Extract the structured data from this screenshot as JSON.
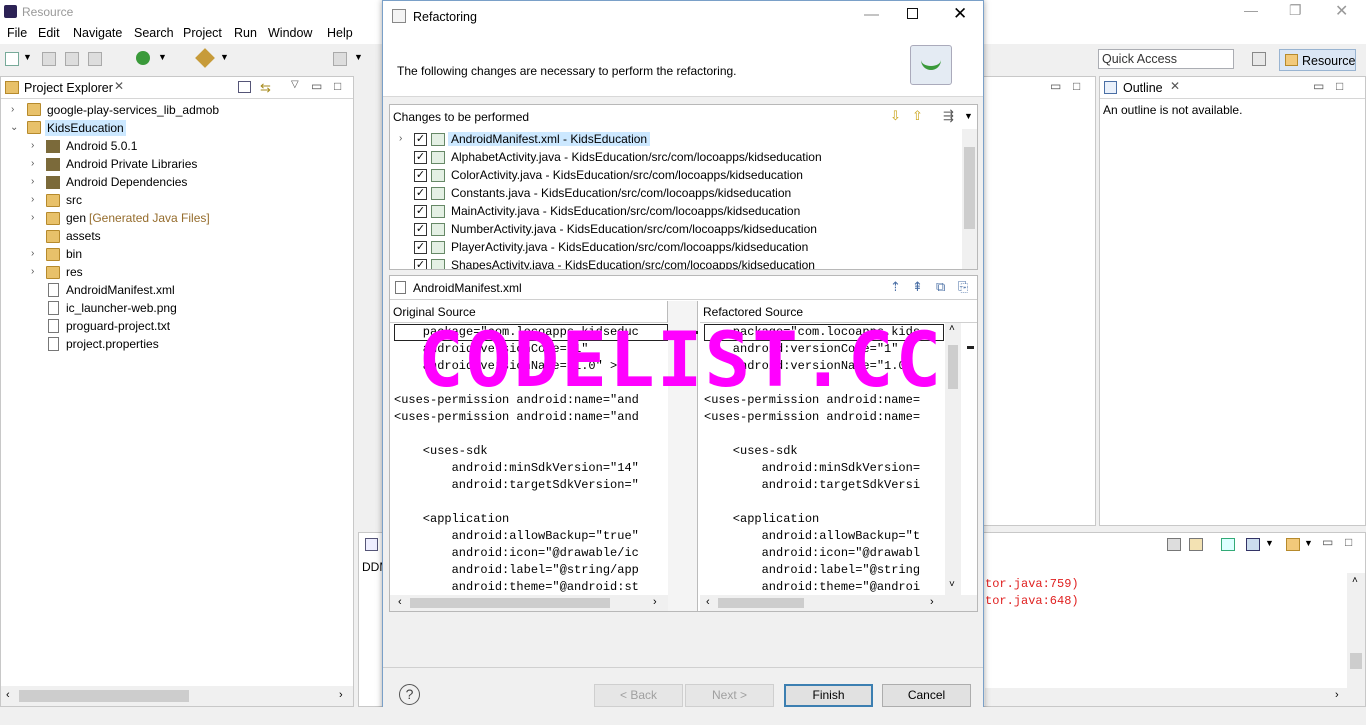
{
  "window": {
    "title": "Resource"
  },
  "menu": [
    "File",
    "Edit",
    "Navigate",
    "Search",
    "Project",
    "Run",
    "Window",
    "Help"
  ],
  "quick_access": {
    "placeholder": "Quick Access"
  },
  "perspective": {
    "label": "Resource"
  },
  "project_explorer": {
    "tab_label": "Project Explorer",
    "items": [
      {
        "label": "google-play-services_lib_admob"
      },
      {
        "label": "KidsEducation"
      },
      {
        "label": "Android 5.0.1"
      },
      {
        "label": "Android Private Libraries"
      },
      {
        "label": "Android Dependencies"
      },
      {
        "label": "src"
      },
      {
        "label": "gen",
        "suffix": "[Generated Java Files]"
      },
      {
        "label": "assets"
      },
      {
        "label": "bin"
      },
      {
        "label": "res"
      },
      {
        "label": "AndroidManifest.xml"
      },
      {
        "label": "ic_launcher-web.png"
      },
      {
        "label": "proguard-project.txt"
      },
      {
        "label": "project.properties"
      }
    ]
  },
  "outline": {
    "tab_label": "Outline",
    "message": "An outline is not available."
  },
  "console": {
    "tab_label": "DDM",
    "lines": [
      "tor.java:759)",
      "tor.java:648)"
    ]
  },
  "dialog": {
    "title": "Refactoring",
    "message": "The following changes are necessary to perform the refactoring.",
    "changes_label": "Changes to be performed",
    "changes": [
      "AndroidManifest.xml - KidsEducation",
      "AlphabetActivity.java - KidsEducation/src/com/locoapps/kidseducation",
      "ColorActivity.java - KidsEducation/src/com/locoapps/kidseducation",
      "Constants.java - KidsEducation/src/com/locoapps/kidseducation",
      "MainActivity.java - KidsEducation/src/com/locoapps/kidseducation",
      "NumberActivity.java - KidsEducation/src/com/locoapps/kidseducation",
      "PlayerActivity.java - KidsEducation/src/com/locoapps/kidseducation",
      "ShapesActivity.java - KidsEducation/src/com/locoapps/kidseducation"
    ],
    "compare_file": "AndroidManifest.xml",
    "original_label": "Original Source",
    "refactored_label": "Refactored Source",
    "original_code": "    package=\"com.locoapps.kidseduc\n    android:versionCode=\"1\"\n    android:versionName=\"1.0\" >\n\n<uses-permission android:name=\"and\n<uses-permission android:name=\"and\n\n    <uses-sdk\n        android:minSdkVersion=\"14\"\n        android:targetSdkVersion=\"\n\n    <application\n        android:allowBackup=\"true\"\n        android:icon=\"@drawable/ic\n        android:label=\"@string/app\n        android:theme=\"@android:st",
    "refactored_code": "    package=\"com.locoapps.kids\n    android:versionCode=\"1\"\n    android:versionName=\"1.0\"\n\n<uses-permission android:name=\n<uses-permission android:name=\n\n    <uses-sdk\n        android:minSdkVersion=\n        android:targetSdkVersi\n\n    <application\n        android:allowBackup=\"t\n        android:icon=\"@drawabl\n        android:label=\"@string\n        android:theme=\"@androi",
    "buttons": {
      "back": "< Back",
      "next": "Next >",
      "finish": "Finish",
      "cancel": "Cancel"
    },
    "help_glyph": "?"
  },
  "watermark": "CODELIST.CC"
}
